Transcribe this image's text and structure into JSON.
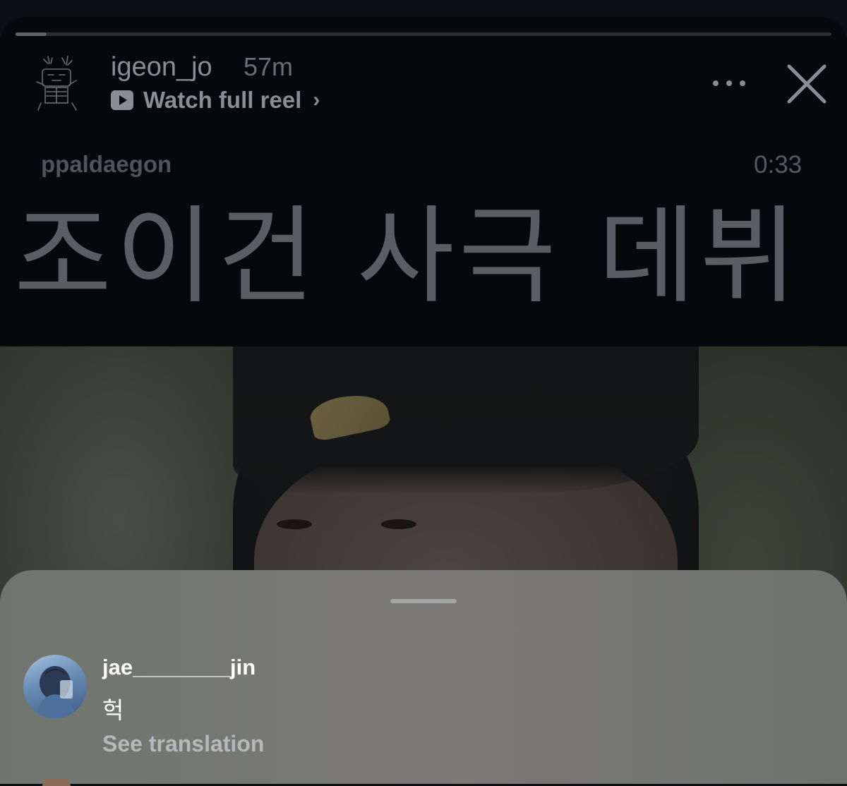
{
  "story": {
    "progress_fraction": 0.038,
    "username": "igeon_jo",
    "time_ago": "57m",
    "watch_full_reel": "Watch full reel",
    "reel_author": "ppaldaegon",
    "reel_duration": "0:33",
    "reel_title": "조이건 사극 데뷔"
  },
  "icons": {
    "play": "play-icon",
    "chevron": "chevron-right-icon",
    "more": "more-options-icon",
    "close": "close-icon"
  },
  "comments_sheet": {
    "comments": [
      {
        "username": "jae________jin",
        "text": "헉",
        "translate_link": "See translation"
      }
    ]
  },
  "colors": {
    "background": "#06080c",
    "sheet": "#777a75",
    "comment_text": "#ffffff",
    "translation_link": "#b5b9bc"
  }
}
